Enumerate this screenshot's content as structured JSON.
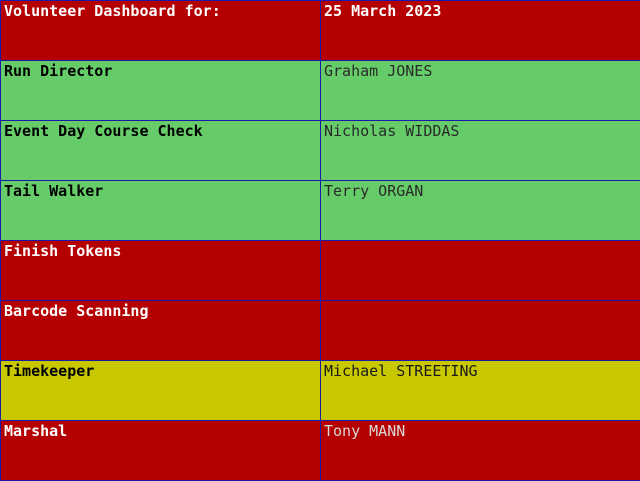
{
  "colors": {
    "unfilled": "#b40000",
    "filled": "#66cc6a",
    "pending": "#c8c800",
    "grid_line": "#1a1aa8"
  },
  "header": {
    "label": "Volunteer Dashboard for:",
    "date": "25 March 2023",
    "status": "unfilled"
  },
  "roles": [
    {
      "role": "Run Director",
      "volunteer": "Graham JONES",
      "status": "filled"
    },
    {
      "role": "Event Day Course Check",
      "volunteer": "Nicholas WIDDAS",
      "status": "filled"
    },
    {
      "role": "Tail Walker",
      "volunteer": "Terry ORGAN",
      "status": "filled"
    },
    {
      "role": "Finish Tokens",
      "volunteer": "",
      "status": "unfilled"
    },
    {
      "role": "Barcode Scanning",
      "volunteer": "",
      "status": "unfilled"
    },
    {
      "role": "Timekeeper",
      "volunteer": "Michael STREETING",
      "status": "pending"
    },
    {
      "role": "Marshal",
      "volunteer": "Tony MANN",
      "status": "unfilled"
    }
  ]
}
